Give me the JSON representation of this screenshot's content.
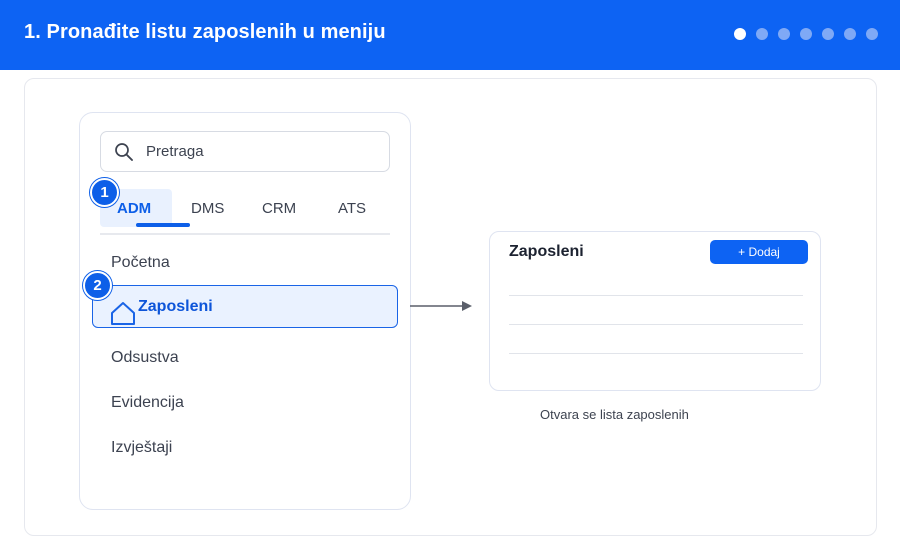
{
  "header": {
    "title": "1. Pronađite listu zaposlenih u meniju",
    "steps_total": 7,
    "step_active": 1
  },
  "sidebar": {
    "search": {
      "placeholder": "Pretraga",
      "icon": "search-icon"
    },
    "tabs": [
      {
        "label": "ADM",
        "active": true
      },
      {
        "label": "DMS",
        "active": false
      },
      {
        "label": "CRM",
        "active": false
      },
      {
        "label": "ATS",
        "active": false
      }
    ],
    "items": [
      {
        "label": "Početna",
        "selected": false
      },
      {
        "label": "Zaposleni",
        "selected": true,
        "icon": "home-icon"
      },
      {
        "label": "Odsustva",
        "selected": false
      },
      {
        "label": "Evidencija",
        "selected": false
      },
      {
        "label": "Izvještaji",
        "selected": false
      }
    ]
  },
  "badges": {
    "tab_step": "1",
    "item_step": "2"
  },
  "result_card": {
    "title": "Zaposleni",
    "add_button_label": "+ Dodaj"
  },
  "caption": "Otvara se lista zaposlenih",
  "colors": {
    "brand": "#0d63f3",
    "accent_text": "#0d5fe8",
    "selected_bg": "#eaf2ff",
    "inactive_dot": "#7fa9f6"
  }
}
